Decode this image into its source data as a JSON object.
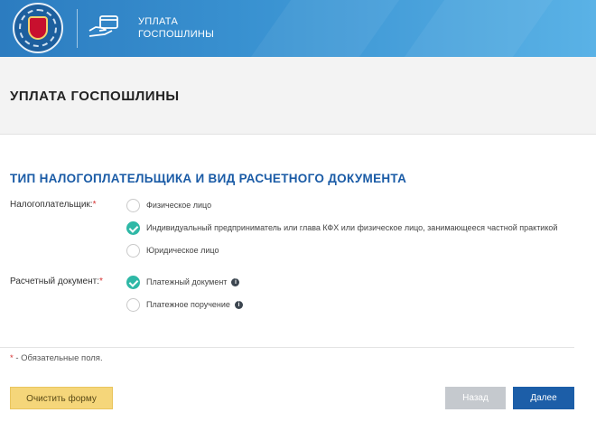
{
  "header": {
    "title_line1": "УПЛАТА",
    "title_line2": "ГОСПОШЛИНЫ",
    "logo_icon": "fns-emblem-icon",
    "service_icon": "hand-card-icon"
  },
  "page": {
    "title": "УПЛАТА ГОСПОШЛИНЫ"
  },
  "section": {
    "title": "ТИП НАЛОГОПЛАТЕЛЬЩИКА И ВИД РАСЧЕТНОГО ДОКУМЕНТА"
  },
  "taxpayer": {
    "label": "Налогоплательщик:",
    "required_mark": "*",
    "options": [
      {
        "label": "Физическое лицо",
        "checked": false
      },
      {
        "label": "Индивидуальный предприниматель или глава КФХ или физическое лицо, занимающееся частной практикой",
        "checked": true
      },
      {
        "label": "Юридическое лицо",
        "checked": false
      }
    ]
  },
  "document": {
    "label": "Расчетный документ:",
    "required_mark": "*",
    "options": [
      {
        "label": "Платежный документ",
        "checked": true,
        "info_icon": "info-icon"
      },
      {
        "label": "Платежное поручение",
        "checked": false,
        "info_icon": "info-icon"
      }
    ]
  },
  "footer": {
    "required_mark": "*",
    "required_note": " - Обязательные поля."
  },
  "buttons": {
    "clear": "Очистить форму",
    "back": "Назад",
    "next": "Далее"
  },
  "colors": {
    "header_blue": "#3a93d2",
    "accent_blue": "#1a5ba6",
    "check_teal": "#2fb8a6",
    "clear_yellow": "#f5d67a",
    "required_red": "#d63232"
  }
}
